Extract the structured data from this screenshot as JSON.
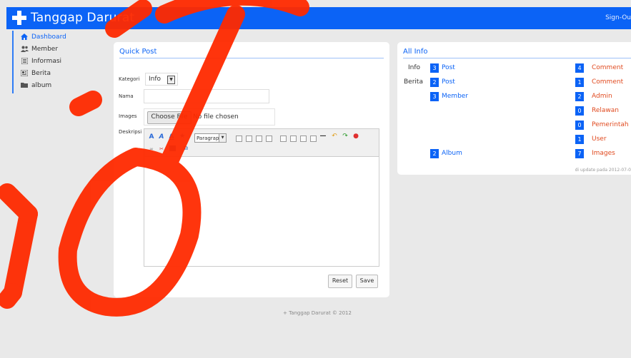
{
  "app": {
    "title": "Tanggap Darurat",
    "signout": "Sign-Ou"
  },
  "sidebar": {
    "items": [
      {
        "label": "Dashboard",
        "icon": "home-icon"
      },
      {
        "label": "Member",
        "icon": "users-icon"
      },
      {
        "label": "Informasi",
        "icon": "list-icon"
      },
      {
        "label": "Berita",
        "icon": "newspaper-icon"
      },
      {
        "label": "album",
        "icon": "folder-icon"
      }
    ]
  },
  "quick_post": {
    "title": "Quick Post",
    "kategori_label": "Kategori",
    "kategori_value": "Info",
    "nama_label": "Nama",
    "images_label": "Images",
    "choose_file": "Choose File",
    "no_file": "No file chosen",
    "deskripsi_label": "Deskripsi",
    "format_value": "Paragraph",
    "reset_label": "Reset",
    "save_label": "Save"
  },
  "all_info": {
    "title": "All Info",
    "left": [
      {
        "group": "Info",
        "count": "3",
        "label": "Post"
      },
      {
        "group": "Berita",
        "count": "2",
        "label": "Post"
      },
      {
        "group": "",
        "count": "3",
        "label": "Member"
      },
      {
        "group": "",
        "count": "2",
        "label": "Album"
      }
    ],
    "right": [
      {
        "count": "4",
        "label": "Comment"
      },
      {
        "count": "1",
        "label": "Comment"
      },
      {
        "count": "2",
        "label": "Admin"
      },
      {
        "count": "0",
        "label": "Relawan"
      },
      {
        "count": "0",
        "label": "Pemerintah"
      },
      {
        "count": "1",
        "label": "User"
      },
      {
        "count": "7",
        "label": "Images"
      }
    ],
    "updated": "di update pada 2012-07-0"
  },
  "footer": "+ Tanggap Darurat © 2012",
  "colors": {
    "brand": "#0b63f6",
    "accent_red": "#e04a1f",
    "watermark": "#ff2a00"
  }
}
